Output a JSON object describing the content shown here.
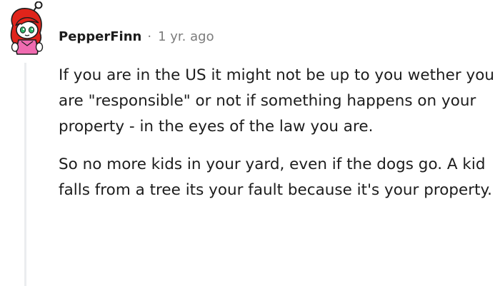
{
  "comment": {
    "author": "PepperFinn",
    "separator": "·",
    "timestamp": "1 yr. ago",
    "avatar_icon": "snoo-avatar-red-hair-icon",
    "paragraphs": [
      "If you are in the US it might not be up to you wether you are \"responsible\" or not if something happens on your property - in the eyes of the law you are.",
      "So no more kids in your yard, even if the dogs go. A kid falls from a tree its your fault because it's your property."
    ]
  },
  "colors": {
    "text": "#1c1c1c",
    "meta": "#7c7c7c",
    "thread_line": "#ebedef",
    "avatar_hair": "#e0241b",
    "avatar_face": "#ffffff",
    "avatar_eyes": "#2fb86c",
    "avatar_dress": "#f06bb0"
  }
}
